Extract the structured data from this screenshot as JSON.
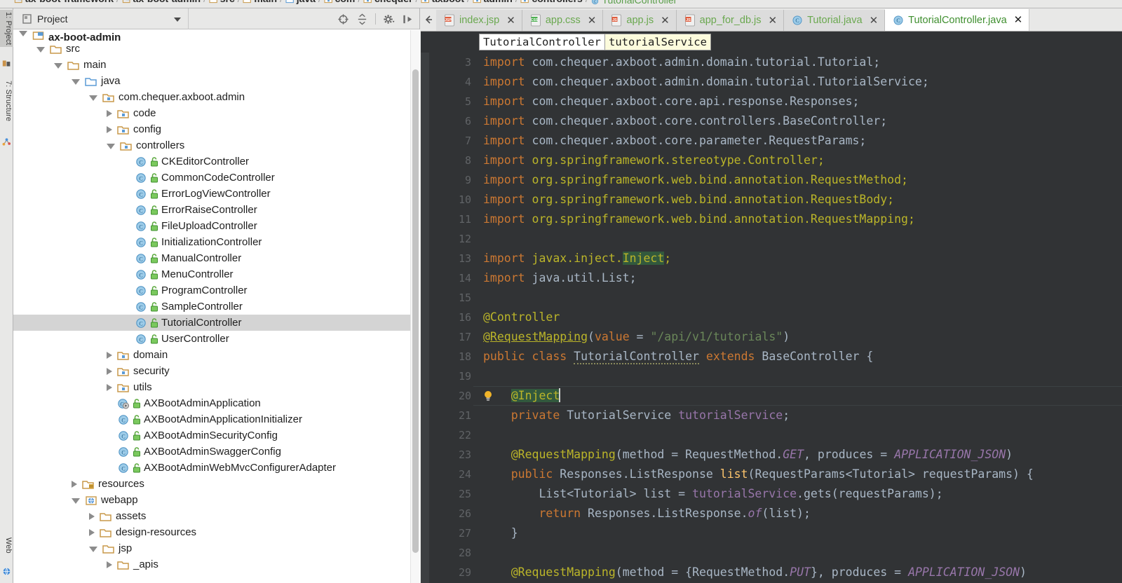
{
  "window": {
    "breadcrumb": [
      {
        "label": "ax-boot-framework",
        "icon": "module-icon"
      },
      {
        "label": "ax-boot-admin",
        "icon": "module-icon"
      },
      {
        "label": "src",
        "icon": "folder-icon"
      },
      {
        "label": "main",
        "icon": "folder-icon"
      },
      {
        "label": "java",
        "icon": "source-folder-icon"
      },
      {
        "label": "com",
        "icon": "package-icon"
      },
      {
        "label": "chequer",
        "icon": "package-icon"
      },
      {
        "label": "axboot",
        "icon": "package-icon"
      },
      {
        "label": "admin",
        "icon": "package-icon"
      },
      {
        "label": "controllers",
        "icon": "package-icon"
      },
      {
        "label": "TutorialController",
        "icon": "class-icon"
      }
    ]
  },
  "toolwindows": [
    {
      "label": "1: Project",
      "shortcut": "1",
      "active": true,
      "icon": "project-icon"
    },
    {
      "label": "7: Structure",
      "shortcut": "7",
      "active": false,
      "icon": "structure-icon"
    },
    {
      "label": "Web",
      "shortcut": "",
      "active": false,
      "icon": "web-icon"
    }
  ],
  "project_panel": {
    "title": "Project",
    "actions": [
      {
        "name": "scroll-from-source-icon",
        "label": "Select Opened File"
      },
      {
        "name": "collapse-all-icon",
        "label": "Collapse All"
      },
      {
        "name": "gear-icon",
        "label": "Settings"
      },
      {
        "name": "hide-icon",
        "label": "Hide"
      }
    ],
    "tree": [
      {
        "label": "ax-boot-admin",
        "indent": 1,
        "twist": "open",
        "icon": "module-icon",
        "bold": true,
        "clipped": true,
        "selected": false
      },
      {
        "label": "src",
        "indent": 2,
        "twist": "open",
        "icon": "folder-icon",
        "bold": false,
        "selected": false
      },
      {
        "label": "main",
        "indent": 3,
        "twist": "open",
        "icon": "folder-icon",
        "bold": false,
        "selected": false
      },
      {
        "label": "java",
        "indent": 4,
        "twist": "open",
        "icon": "source-folder-icon",
        "bold": false,
        "selected": false
      },
      {
        "label": "com.chequer.axboot.admin",
        "indent": 5,
        "twist": "open",
        "icon": "package-icon",
        "bold": false,
        "selected": false
      },
      {
        "label": "code",
        "indent": 6,
        "twist": "closed",
        "icon": "package-icon",
        "bold": false,
        "selected": false
      },
      {
        "label": "config",
        "indent": 6,
        "twist": "closed",
        "icon": "package-icon",
        "bold": false,
        "selected": false
      },
      {
        "label": "controllers",
        "indent": 6,
        "twist": "open",
        "icon": "package-icon",
        "bold": false,
        "selected": false
      },
      {
        "label": "CKEditorController",
        "indent": 7,
        "twist": "none",
        "icon": "class-icon",
        "lock": true,
        "selected": false
      },
      {
        "label": "CommonCodeController",
        "indent": 7,
        "twist": "none",
        "icon": "class-icon",
        "lock": true,
        "selected": false
      },
      {
        "label": "ErrorLogViewController",
        "indent": 7,
        "twist": "none",
        "icon": "class-icon",
        "lock": true,
        "selected": false
      },
      {
        "label": "ErrorRaiseController",
        "indent": 7,
        "twist": "none",
        "icon": "class-icon",
        "lock": true,
        "selected": false
      },
      {
        "label": "FileUploadController",
        "indent": 7,
        "twist": "none",
        "icon": "class-icon",
        "lock": true,
        "selected": false
      },
      {
        "label": "InitializationController",
        "indent": 7,
        "twist": "none",
        "icon": "class-icon",
        "lock": true,
        "selected": false
      },
      {
        "label": "ManualController",
        "indent": 7,
        "twist": "none",
        "icon": "class-icon",
        "lock": true,
        "selected": false
      },
      {
        "label": "MenuController",
        "indent": 7,
        "twist": "none",
        "icon": "class-icon",
        "lock": true,
        "selected": false
      },
      {
        "label": "ProgramController",
        "indent": 7,
        "twist": "none",
        "icon": "class-icon",
        "lock": true,
        "selected": false
      },
      {
        "label": "SampleController",
        "indent": 7,
        "twist": "none",
        "icon": "class-icon",
        "lock": true,
        "selected": false
      },
      {
        "label": "TutorialController",
        "indent": 7,
        "twist": "none",
        "icon": "class-icon",
        "lock": true,
        "selected": true
      },
      {
        "label": "UserController",
        "indent": 7,
        "twist": "none",
        "icon": "class-icon",
        "lock": true,
        "selected": false
      },
      {
        "label": "domain",
        "indent": 6,
        "twist": "closed",
        "icon": "package-icon",
        "selected": false
      },
      {
        "label": "security",
        "indent": 6,
        "twist": "closed",
        "icon": "package-icon",
        "selected": false
      },
      {
        "label": "utils",
        "indent": 6,
        "twist": "closed",
        "icon": "package-icon",
        "selected": false
      },
      {
        "label": "AXBootAdminApplication",
        "indent": 6,
        "twist": "none",
        "icon": "runnable-class-icon",
        "lock": true,
        "selected": false
      },
      {
        "label": "AXBootAdminApplicationInitializer",
        "indent": 6,
        "twist": "none",
        "icon": "class-icon",
        "lock": true,
        "selected": false
      },
      {
        "label": "AXBootAdminSecurityConfig",
        "indent": 6,
        "twist": "none",
        "icon": "class-icon",
        "lock": true,
        "selected": false
      },
      {
        "label": "AXBootAdminSwaggerConfig",
        "indent": 6,
        "twist": "none",
        "icon": "class-icon",
        "lock": true,
        "selected": false
      },
      {
        "label": "AXBootAdminWebMvcConfigurerAdapter",
        "indent": 6,
        "twist": "none",
        "icon": "class-icon",
        "lock": true,
        "selected": false
      },
      {
        "label": "resources",
        "indent": 4,
        "twist": "closed",
        "icon": "resources-folder-icon",
        "selected": false
      },
      {
        "label": "webapp",
        "indent": 4,
        "twist": "open",
        "icon": "webapp-folder-icon",
        "selected": false
      },
      {
        "label": "assets",
        "indent": 5,
        "twist": "closed",
        "icon": "folder-icon",
        "selected": false
      },
      {
        "label": "design-resources",
        "indent": 5,
        "twist": "closed",
        "icon": "folder-icon",
        "selected": false
      },
      {
        "label": "jsp",
        "indent": 5,
        "twist": "open",
        "icon": "folder-icon",
        "selected": false
      },
      {
        "label": "_apis",
        "indent": 6,
        "twist": "closed",
        "icon": "folder-icon",
        "selected": false
      }
    ]
  },
  "editor": {
    "tabs": [
      {
        "label": "index.jsp",
        "icon": "jsp-file-icon",
        "active": false
      },
      {
        "label": "app.css",
        "icon": "css-file-icon",
        "active": false
      },
      {
        "label": "app.js",
        "icon": "js-file-icon",
        "active": false
      },
      {
        "label": "app_for_db.js",
        "icon": "js-file-icon",
        "active": false
      },
      {
        "label": "Tutorial.java",
        "icon": "class-icon",
        "active": false
      },
      {
        "label": "TutorialController.java",
        "icon": "class-icon",
        "active": true
      }
    ],
    "structure_breadcrumb": [
      {
        "label": "TutorialController",
        "highlight": false
      },
      {
        "label": "tutorialService",
        "highlight": true
      }
    ],
    "first_line_number": 3,
    "lines": [
      {
        "n": 3,
        "text": "import com.chequer.axboot.admin.domain.tutorial.Tutorial;",
        "fold": "start"
      },
      {
        "n": 4,
        "text": "import com.chequer.axboot.admin.domain.tutorial.TutorialService;",
        "fold": ""
      },
      {
        "n": 5,
        "text": "import com.chequer.axboot.core.api.response.Responses;",
        "fold": ""
      },
      {
        "n": 6,
        "text": "import com.chequer.axboot.core.controllers.BaseController;",
        "fold": ""
      },
      {
        "n": 7,
        "text": "import com.chequer.axboot.core.parameter.RequestParams;",
        "fold": ""
      },
      {
        "n": 8,
        "text": "import org.springframework.stereotype.Controller;",
        "fold": ""
      },
      {
        "n": 9,
        "text": "import org.springframework.web.bind.annotation.RequestMethod;",
        "fold": ""
      },
      {
        "n": 10,
        "text": "import org.springframework.web.bind.annotation.RequestBody;",
        "fold": ""
      },
      {
        "n": 11,
        "text": "import org.springframework.web.bind.annotation.RequestMapping;",
        "fold": ""
      },
      {
        "n": 12,
        "text": "",
        "fold": ""
      },
      {
        "n": 13,
        "text": "import javax.inject.Inject;",
        "fold": ""
      },
      {
        "n": 14,
        "text": "import java.util.List;",
        "fold": "end"
      },
      {
        "n": 15,
        "text": "",
        "fold": ""
      },
      {
        "n": 16,
        "text": "@Controller",
        "fold": "start"
      },
      {
        "n": 17,
        "text": "@RequestMapping(value = \"/api/v1/tutorials\")",
        "fold": "end"
      },
      {
        "n": 18,
        "text": "public class TutorialController extends BaseController {",
        "fold": ""
      },
      {
        "n": 19,
        "text": "",
        "fold": ""
      },
      {
        "n": 20,
        "text": "    @Inject",
        "fold": "",
        "bulb": true,
        "caret": true
      },
      {
        "n": 21,
        "text": "    private TutorialService tutorialService;",
        "fold": ""
      },
      {
        "n": 22,
        "text": "",
        "fold": ""
      },
      {
        "n": 23,
        "text": "    @RequestMapping(method = RequestMethod.GET, produces = APPLICATION_JSON)",
        "fold": ""
      },
      {
        "n": 24,
        "text": "    public Responses.ListResponse list(RequestParams<Tutorial> requestParams) {",
        "fold": "start"
      },
      {
        "n": 25,
        "text": "        List<Tutorial> list = tutorialService.gets(requestParams);",
        "fold": ""
      },
      {
        "n": 26,
        "text": "        return Responses.ListResponse.of(list);",
        "fold": ""
      },
      {
        "n": 27,
        "text": "    }",
        "fold": "end"
      },
      {
        "n": 28,
        "text": "",
        "fold": ""
      },
      {
        "n": 29,
        "text": "    @RequestMapping(method = {RequestMethod.PUT}, produces = APPLICATION_JSON)",
        "fold": ""
      }
    ]
  },
  "colors": {
    "editor_bg": "#313335",
    "gutter_bg": "#313335",
    "keyword": "#cc7832",
    "annotation": "#bbb529",
    "string": "#6a8759",
    "field": "#9876aa",
    "method": "#ffc66d",
    "text": "#a9b7c6",
    "line_number": "#606366",
    "selection_highlight": "#32593d",
    "tab_label_green": "#6aa84f",
    "panel_bg": "#e8e8e7",
    "tree_selected": "#d4d4d4"
  }
}
